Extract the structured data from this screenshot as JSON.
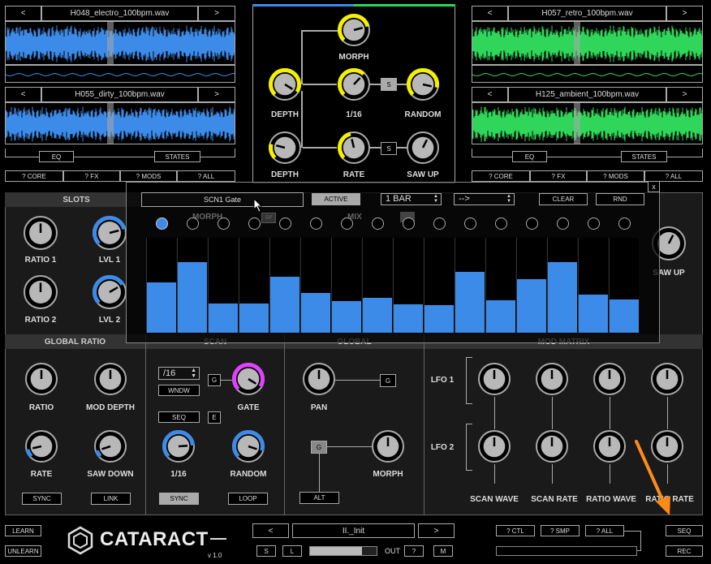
{
  "colors": {
    "blue": "#3d8be8",
    "green": "#2fd65a",
    "yellow": "#f4f000",
    "magenta": "#e040ff",
    "panel_bg": "#1a1a1a",
    "header_bg": "#333333",
    "arrow": "#ff8a1a"
  },
  "samples": {
    "top_left": {
      "prev": "<",
      "name": "H048_electro_100bpm.wav",
      "next": ">"
    },
    "bottom_left": {
      "prev": "<",
      "name": "H055_dirty_100bpm.wav",
      "next": ">"
    },
    "top_right": {
      "prev": "<",
      "name": "H057_retro_100bpm.wav",
      "next": ">"
    },
    "bottom_right": {
      "prev": "<",
      "name": "H125_ambient_100bpm.wav",
      "next": ">"
    }
  },
  "left_buttons": {
    "eq": "EQ",
    "states": "STATES",
    "core": "? CORE",
    "fx": "? FX",
    "mods": "? MODS",
    "all": "? ALL"
  },
  "right_buttons": {
    "eq": "EQ",
    "states": "STATES",
    "core": "? CORE",
    "fx": "? FX",
    "mods": "? MODS",
    "all": "? ALL"
  },
  "center": {
    "morph": "MORPH",
    "depth1": "DEPTH",
    "div": "1/16",
    "s1": "S",
    "random": "RANDOM",
    "depth2": "DEPTH",
    "rate": "RATE",
    "s2": "S",
    "saw_up": "SAW UP"
  },
  "slots": {
    "title": "SLOTS",
    "ratio1": "RATIO 1",
    "lvl1": "LVL 1",
    "ratio2": "RATIO 2",
    "lvl2": "LVL 2",
    "saw_up": "SAW UP"
  },
  "sections": {
    "global_ratio": "GLOBAL RATIO",
    "scan": "SCAN",
    "global": "GLOBAL",
    "mod_matrix": "MOD MATRIX"
  },
  "global_ratio": {
    "ratio": "RATIO",
    "mod_depth": "MOD DEPTH",
    "rate": "RATE",
    "saw_down": "SAW DOWN",
    "sync": "SYNC",
    "link": "LINK"
  },
  "scan": {
    "div_value": "/16",
    "wndw": "WNDW",
    "g": "G",
    "gate": "GATE",
    "seq": "SEQ",
    "e": "E",
    "div": "1/16",
    "random": "RANDOM",
    "sync": "SYNC",
    "loop": "LOOP"
  },
  "global": {
    "pan": "PAN",
    "g1": "G",
    "g2": "G",
    "morph": "MORPH",
    "alt": "ALT"
  },
  "mod_matrix": {
    "lfo1": "LFO 1",
    "lfo2": "LFO 2",
    "scan_wave": "SCAN WAVE",
    "scan_rate": "SCAN RATE",
    "ratio_wave": "RATIO WAVE",
    "ratio_rate": "RATIO RATE"
  },
  "sequencer": {
    "close": "x",
    "name": "SCN1 Gate",
    "active": "ACTIVE",
    "length": "1 BAR",
    "direction": "-->",
    "clear": "CLEAR",
    "rnd": "RND",
    "step_values": [
      0.53,
      0.74,
      0.31,
      0.31,
      0.59,
      0.42,
      0.33,
      0.37,
      0.3,
      0.29,
      0.64,
      0.34,
      0.56,
      0.74,
      0.4,
      0.35
    ],
    "active_step": 1,
    "ghost": {
      "morph": "MORPH",
      "mix": "MIX",
      "sp": "SP"
    }
  },
  "footer": {
    "learn": "LEARN",
    "unlearn": "UNLEARN",
    "logo": "CATARACT",
    "version": "v 1.0",
    "prev": "<",
    "preset": "II._Init",
    "next": ">",
    "s": "S",
    "l": "L",
    "out": "OUT",
    "q": "?",
    "m": "M",
    "ctl": "? CTL",
    "smp": "? SMP",
    "all": "? ALL",
    "seq": "SEQ",
    "rec": "REC"
  }
}
